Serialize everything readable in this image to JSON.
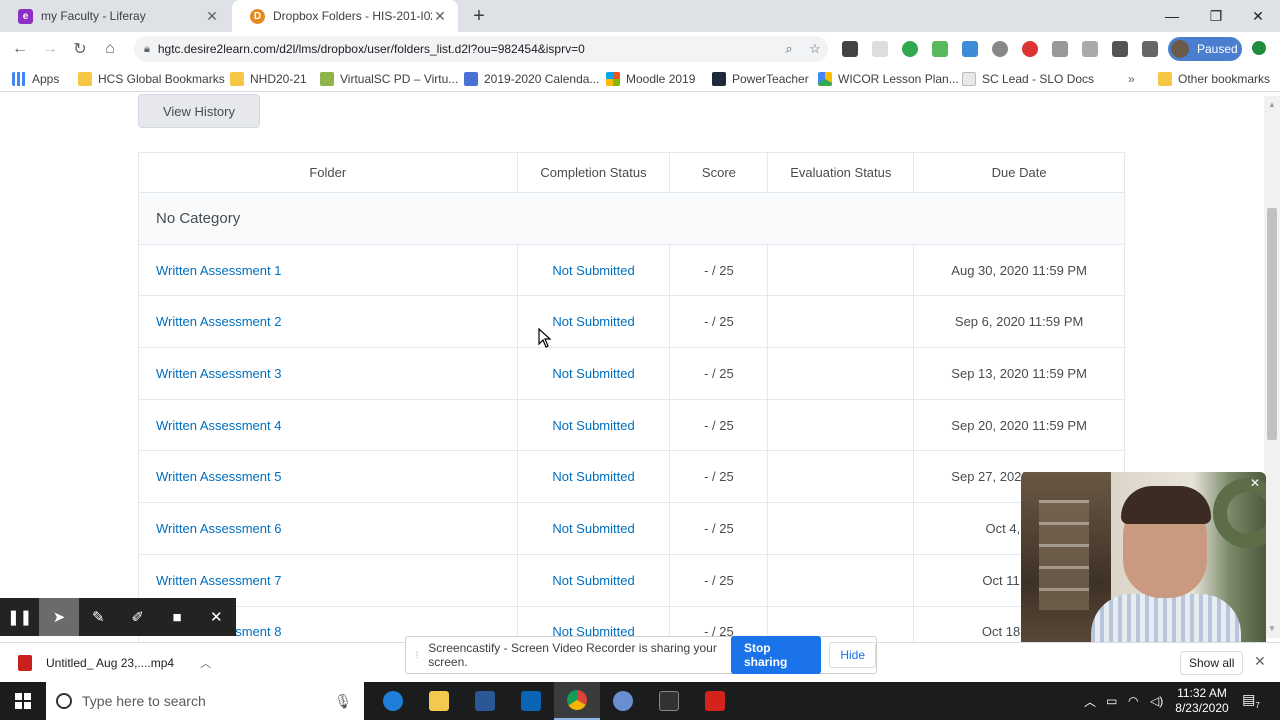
{
  "browser": {
    "tabs": [
      {
        "label": "my Faculty - Liferay",
        "active": false
      },
      {
        "label": "Dropbox Folders - HIS-201-I02 -",
        "active": true
      }
    ],
    "url": "hgtc.desire2learn.com/d2l/lms/dropbox/user/folders_list.d2l?ou=982454&isprv=0",
    "profile_label": "Paused",
    "bookmarks": [
      {
        "label": "Apps",
        "icon": "apps-grid-icon"
      },
      {
        "label": "HCS Global Bookmarks",
        "icon": "folder-icon"
      },
      {
        "label": "NHD20-21",
        "icon": "folder-icon"
      },
      {
        "label": "VirtualSC PD – Virtu...",
        "icon": "virtualsc-icon"
      },
      {
        "label": "2019-2020 Calenda...",
        "icon": "docs-icon"
      },
      {
        "label": "Moodle 2019",
        "icon": "microsoft-icon"
      },
      {
        "label": "PowerTeacher",
        "icon": "powerteacher-icon"
      },
      {
        "label": "WICOR Lesson Plan...",
        "icon": "drive-icon"
      },
      {
        "label": "SC Lead - SLO Docs",
        "icon": "page-icon"
      }
    ],
    "other_bookmarks": "Other bookmarks"
  },
  "page": {
    "history_button": "View History",
    "columns": [
      "Folder",
      "Completion Status",
      "Score",
      "Evaluation Status",
      "Due Date"
    ],
    "category": "No Category",
    "rows": [
      {
        "folder": "Written Assessment 1",
        "status": "Not Submitted",
        "score": "- / 25",
        "evaluation": "",
        "due": "Aug 30, 2020 11:59 PM"
      },
      {
        "folder": "Written Assessment 2",
        "status": "Not Submitted",
        "score": "- / 25",
        "evaluation": "",
        "due": "Sep 6, 2020 11:59 PM"
      },
      {
        "folder": "Written Assessment 3",
        "status": "Not Submitted",
        "score": "- / 25",
        "evaluation": "",
        "due": "Sep 13, 2020 11:59 PM"
      },
      {
        "folder": "Written Assessment 4",
        "status": "Not Submitted",
        "score": "- / 25",
        "evaluation": "",
        "due": "Sep 20, 2020 11:59 PM"
      },
      {
        "folder": "Written Assessment 5",
        "status": "Not Submitted",
        "score": "- / 25",
        "evaluation": "",
        "due": "Sep 27, 2020 11:59 PM"
      },
      {
        "folder": "Written Assessment 6",
        "status": "Not Submitted",
        "score": "- / 25",
        "evaluation": "",
        "due": "Oct 4, 2020"
      },
      {
        "folder": "Written Assessment 7",
        "status": "Not Submitted",
        "score": "- / 25",
        "evaluation": "",
        "due": "Oct 11, 2020"
      },
      {
        "folder": "Written Assessment 8",
        "status": "Not Submitted",
        "score": "- / 25",
        "evaluation": "",
        "due": "Oct 18, 2020"
      }
    ]
  },
  "screencastify": {
    "share_message": "Screencastify - Screen Video Recorder is sharing your screen.",
    "stop_label": "Stop sharing",
    "hide_label": "Hide"
  },
  "downloads": {
    "file": "Untitled_ Aug 23,....mp4",
    "show_all": "Show all"
  },
  "taskbar": {
    "search_placeholder": "Type here to search",
    "time": "11:32 AM",
    "date": "8/23/2020",
    "notification_count": "7"
  }
}
